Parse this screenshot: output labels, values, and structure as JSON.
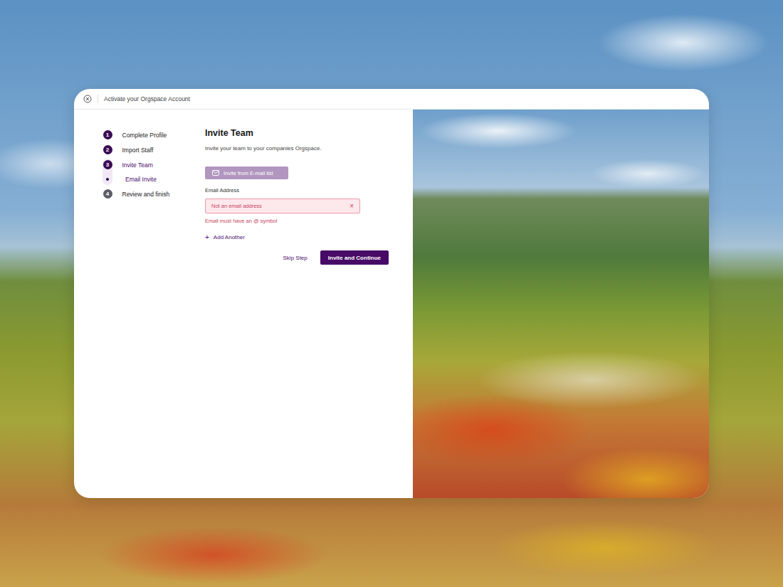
{
  "header": {
    "title": "Activate your Orgspace Account"
  },
  "steps": [
    {
      "number": "1",
      "label": "Complete Profile",
      "completed": true,
      "selected": false,
      "substeps": []
    },
    {
      "number": "2",
      "label": "Import Staff",
      "completed": true,
      "selected": false,
      "substeps": []
    },
    {
      "number": "3",
      "label": "Invite Team",
      "completed": false,
      "selected": true,
      "substeps": [
        {
          "label": "Email Invite",
          "selected": true
        }
      ]
    },
    {
      "number": "4",
      "label": "Review and finish",
      "completed": false,
      "selected": false,
      "substeps": []
    }
  ],
  "form": {
    "title": "Invite Team",
    "description": "Invite your team to your companies Orgspace.",
    "import_button": "Invite from E-mail list",
    "field_label": "Email Address",
    "fields": [
      {
        "value": "Not an email address",
        "invalid": true,
        "clear": "×",
        "error": "Email must have an @ symbol"
      }
    ],
    "add_icon": "+",
    "add_label": "Add Another"
  },
  "actions": {
    "skip": "Skip Step",
    "primary": "Invite and Continue"
  }
}
